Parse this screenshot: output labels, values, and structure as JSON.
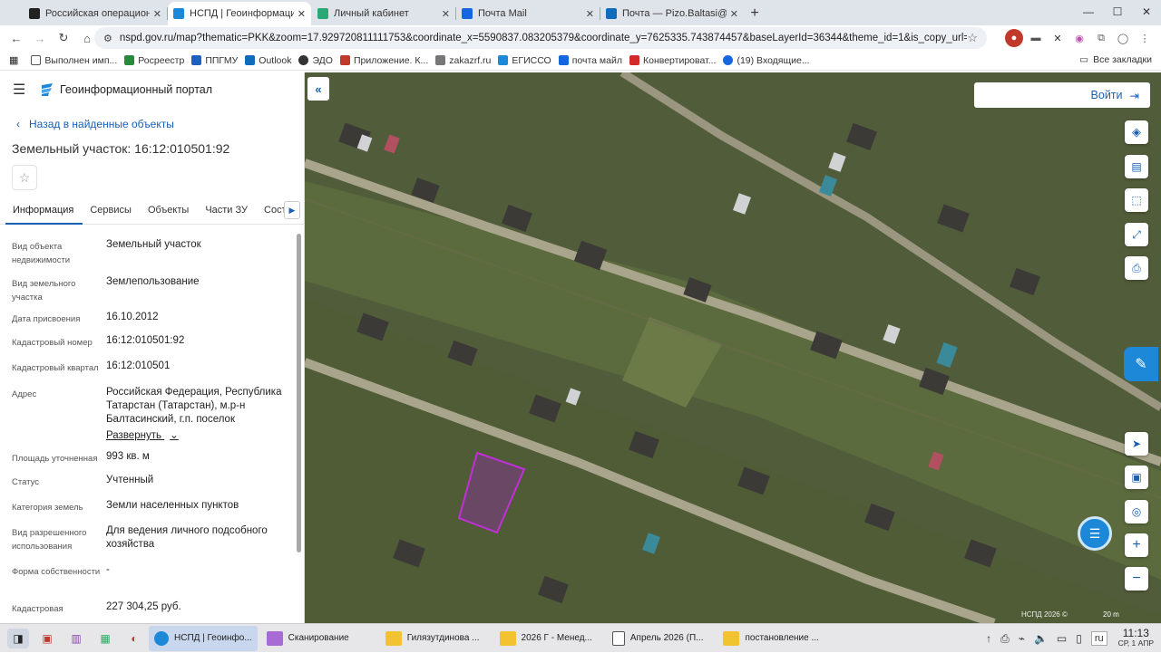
{
  "browser": {
    "tabs": [
      {
        "title": "Российская операционн",
        "color": "#222222"
      },
      {
        "title": "НСПД | Геоинформацион",
        "color": "#1e88d8",
        "active": true
      },
      {
        "title": "Личный кабинет",
        "color": "#2aa876"
      },
      {
        "title": "Почта Mail",
        "color": "#1566e0"
      },
      {
        "title": "Почта — Pizo.Baltasi@tat",
        "color": "#0f6cbd"
      }
    ],
    "new_tab": "+",
    "url": "nspd.gov.ru/map?thematic=PKK&zoom=17.929720811111753&coordinate_x=5590837.083205379&coordinate_y=7625335.743874457&baseLayerId=36344&theme_id=1&is_copy_url=true&selecte..."
  },
  "bookmarks": {
    "items": [
      {
        "label": "Выполнен имп...",
        "color": "#555555"
      },
      {
        "label": "Росреестр",
        "color": "#2a8a3c"
      },
      {
        "label": "ППГМУ",
        "color": "#1e5fbf"
      },
      {
        "label": "Outlook",
        "color": "#0f6cbd"
      },
      {
        "label": "ЭДО",
        "color": "#333333"
      },
      {
        "label": "Приложение. К...",
        "color": "#c0392b"
      },
      {
        "label": "zakazrf.ru",
        "color": "#777777"
      },
      {
        "label": "ЕГИССО",
        "color": "#1e88d8"
      },
      {
        "label": "почта майл",
        "color": "#1566e0"
      },
      {
        "label": "Конвертироват...",
        "color": "#d42a2a"
      },
      {
        "label": "(19) Входящие...",
        "color": "#1566e0"
      }
    ],
    "all": "Все закладки"
  },
  "panel": {
    "portal_title": "Геоинформационный портал",
    "back_link": "Назад в найденные объекты",
    "object_title": "Земельный участок: 16:12:010501:92",
    "tabs": [
      "Информация",
      "Сервисы",
      "Объекты",
      "Части ЗУ",
      "Состав"
    ],
    "rows": [
      {
        "k": "Вид объекта недвижимости",
        "v": "Земельный участок"
      },
      {
        "k": "Вид земельного участка",
        "v": "Землепользование"
      },
      {
        "k": "Дата присвоения",
        "v": "16.10.2012"
      },
      {
        "k": "Кадастровый номер",
        "v": "16:12:010501:92"
      },
      {
        "k": "Кадастровый квартал",
        "v": "16:12:010501"
      },
      {
        "k": "Адрес",
        "v": "Российская Федерация, Республика Татарстан (Татарстан), м.р-н Балтасинский, г.п. поселок"
      },
      {
        "k": "Площадь уточненная",
        "v": "993 кв. м"
      },
      {
        "k": "Статус",
        "v": "Учтенный"
      },
      {
        "k": "Категория земель",
        "v": "Земли населенных пунктов"
      },
      {
        "k": "Вид разрешенного использования",
        "v": "Для ведения личного подсобного хозяйства"
      },
      {
        "k": "Форма собственности",
        "v": "-"
      },
      {
        "k": "Кадастровая",
        "v": "227 304,25 руб."
      }
    ],
    "expand_label": "Развернуть"
  },
  "map": {
    "login_label": "Войти",
    "copyright": "НСПД 2026 ©",
    "scale": "20 m"
  },
  "taskbar": {
    "items": [
      {
        "label": "НСПД | Геоинфо...",
        "color": "#1e88d8",
        "active": true
      },
      {
        "label": "Сканирование",
        "color": "#a86bd6"
      },
      {
        "label": "Гилязутдинова ...",
        "color": "#f2c230"
      },
      {
        "label": "2026 Г - Менед...",
        "color": "#f2c230"
      },
      {
        "label": "Апрель 2026 (П...",
        "color": "#555555"
      },
      {
        "label": "постановление ...",
        "color": "#f2c230"
      }
    ],
    "lang": "ru",
    "time": "11:13",
    "date": "СР, 1 АПР"
  }
}
